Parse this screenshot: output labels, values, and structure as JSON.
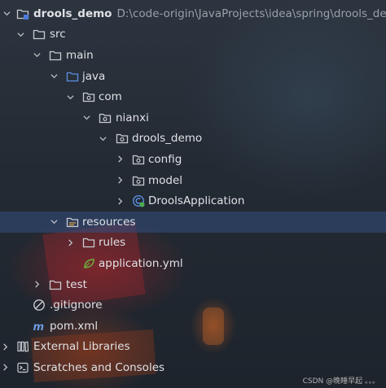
{
  "project": {
    "name": "drools_demo",
    "path": "D:\\code-origin\\JavaProjects\\idea\\spring\\drools_demo"
  },
  "tree": {
    "src": "src",
    "main": "main",
    "java": "java",
    "com": "com",
    "nianxi": "nianxi",
    "drools_demo": "drools_demo",
    "config": "config",
    "model": "model",
    "drools_application": "DroolsApplication",
    "resources": "resources",
    "rules": "rules",
    "application_yml": "application.yml",
    "test": "test",
    "gitignore": ".gitignore",
    "pom": "pom.xml",
    "external_libraries": "External Libraries",
    "scratches": "Scratches and Consoles"
  },
  "watermark": "CSDN @晚睡早起 。。。",
  "colors": {
    "selected_row": "#344e80",
    "folder_blue": "#5c8fe0",
    "text": "#dfe1e5"
  }
}
